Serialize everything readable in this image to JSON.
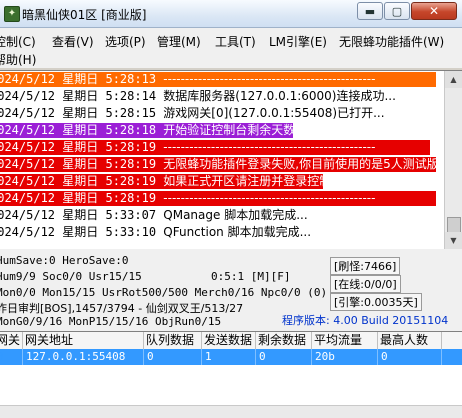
{
  "window": {
    "title": "暗黑仙侠01区 [商业版]",
    "min_glyph": "▬",
    "max_glyph": "▢",
    "close_glyph": "✕"
  },
  "menu": [
    "控制(C)",
    "查看(V)",
    "选项(P)",
    "管理(M)",
    "工具(T)",
    "LM引擎(E)",
    "无限蜂功能插件(W)",
    "帮助(H)"
  ],
  "log": [
    {
      "time": "2024/5/12 星期日 5:28:13",
      "msg": "-------------------------------------------------",
      "style": "orange"
    },
    {
      "time": "2024/5/12 星期日 5:28:14",
      "msg": "数据库服务器(127.0.0.1:6000)连接成功...",
      "style": "normal"
    },
    {
      "time": "2024/5/12 星期日 5:28:15",
      "msg": "游戏网关[0](127.0.0.1:55408)已打开...",
      "style": "normal"
    },
    {
      "time": "2024/5/12 星期日 5:28:18",
      "msg": "开始验证控制台剩余天数...",
      "style": "purple"
    },
    {
      "time": "2024/5/12 星期日 5:28:19",
      "msg": "-------------------------------------------------",
      "style": "red"
    },
    {
      "time": "2024/5/12 星期日 5:28:19",
      "msg": "无限蜂功能插件登录失败,你目前使用的是5人测试版...",
      "style": "red"
    },
    {
      "time": "2024/5/12 星期日 5:28:19",
      "msg": "如果正式开区请注册并登录控制台",
      "style": "red"
    },
    {
      "time": "2024/5/12 星期日 5:28:19",
      "msg": "-------------------------------------------------",
      "style": "red"
    },
    {
      "time": "2024/5/12 星期日 5:33:07",
      "msg": "QManage 脚本加载完成...",
      "style": "normal"
    },
    {
      "time": "2024/5/12 星期日 5:33:10",
      "msg": "QFunction 脚本加载完成...",
      "style": "normal"
    }
  ],
  "status": {
    "line1": "HumSave:0 HeroSave:0",
    "line2": "Hum9/9 Soc0/0 Usr15/15",
    "line2_mid": "0:5:1 [M][F]",
    "line3": "Mon0/0 Mon15/15 UsrRot500/500 Merch0/16 Npc0/0 (0)",
    "line4": "昨日审判[BOS],1457/3794 - 仙剑双叉王/513/27",
    "line5": "MonG0/9/16 MonP15/15/16 ObjRun0/15",
    "refresh": "[刷怪:7466]",
    "online": "[在线:0/0/0]",
    "engine": "[引擎:0.0035天]",
    "version": "程序版本: 4.00 Build 20151104"
  },
  "table": {
    "columns": [
      "网关",
      "网关地址",
      "队列数据",
      "发送数据",
      "剩余数据",
      "平均流量",
      "最高人数"
    ],
    "rows": [
      [
        "0",
        "127.0.0.1:55408",
        "0",
        "1",
        "0",
        "20b",
        "0"
      ]
    ]
  },
  "colors": {
    "highlight_orange": "#ff6a00",
    "highlight_purple": "#9b1fd6",
    "highlight_red": "#e60000",
    "selection_blue": "#3399ff",
    "version_blue": "#0033cc"
  },
  "icons": {
    "app": "game-app-icon",
    "scroll_up": "scroll-up-arrow-icon",
    "scroll_down": "scroll-down-arrow-icon"
  }
}
